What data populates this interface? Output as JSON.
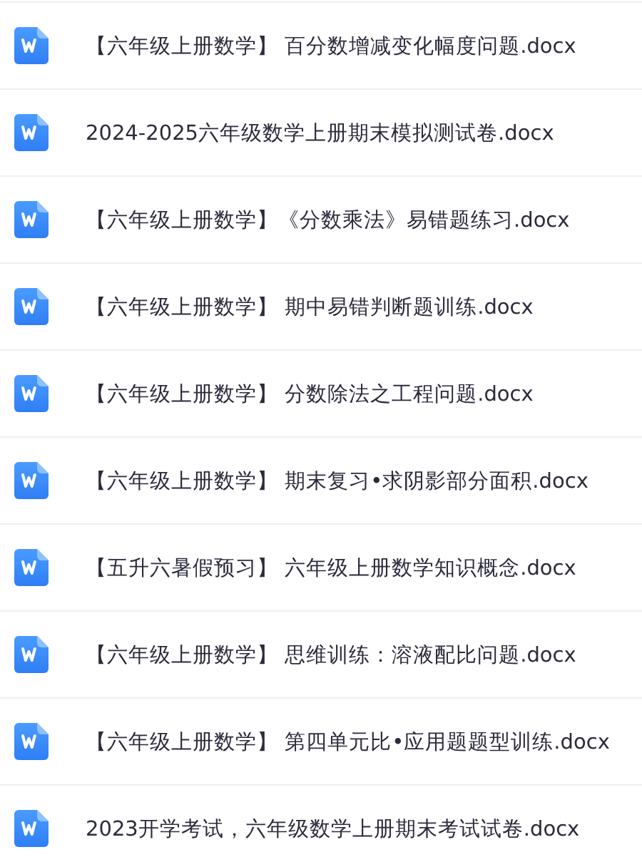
{
  "files": [
    {
      "name": "【六年级上册数学】 百分数增减变化幅度问题.docx"
    },
    {
      "name": "2024-2025六年级数学上册期末模拟测试卷.docx"
    },
    {
      "name": "【六年级上册数学】《分数乘法》易错题练习.docx"
    },
    {
      "name": "【六年级上册数学】 期中易错判断题训练.docx"
    },
    {
      "name": "【六年级上册数学】 分数除法之工程问题.docx"
    },
    {
      "name": "【六年级上册数学】 期末复习•求阴影部分面积.docx"
    },
    {
      "name": "【五升六暑假预习】 六年级上册数学知识概念.docx"
    },
    {
      "name": "【六年级上册数学】 思维训练：溶液配比问题.docx"
    },
    {
      "name": "【六年级上册数学】 第四单元比•应用题题型训练.docx"
    },
    {
      "name": "2023开学考试，六年级数学上册期末考试试卷.docx"
    }
  ]
}
